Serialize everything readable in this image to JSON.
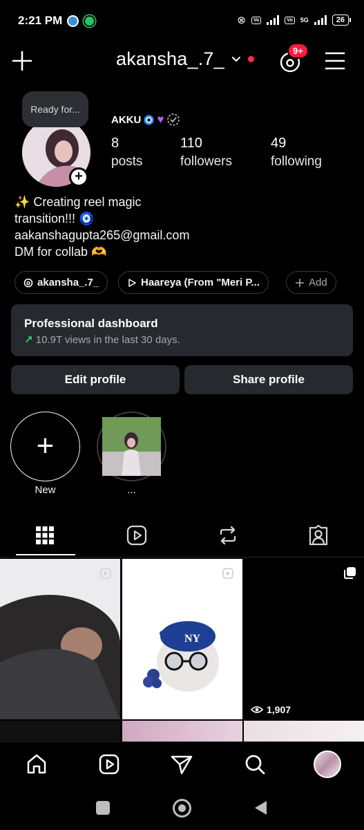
{
  "status_bar": {
    "time": "2:21 PM",
    "network": "5G",
    "battery": "26"
  },
  "header": {
    "username": "akansha_.7_",
    "threads_badge": "9+",
    "icons": [
      "plus-icon",
      "chevron-down-icon",
      "threads-icon",
      "menu-icon"
    ]
  },
  "profile": {
    "note": "Ready for...",
    "display_name": "AKKU",
    "stats": [
      {
        "value": "8",
        "label": "posts"
      },
      {
        "value": "110",
        "label": "followers"
      },
      {
        "value": "49",
        "label": "following"
      }
    ],
    "bio_lines": [
      "✨ Creating reel magic",
      "transition!!! 🧿",
      "aakanshagupta265@gmail.com",
      "DM for collab 🫶"
    ],
    "links": [
      {
        "icon": "threads-icon",
        "label": "akansha_.7_"
      },
      {
        "icon": "play-icon",
        "label": "Haareya (From \"Meri P..."
      },
      {
        "icon": "plus-icon",
        "label": "Add"
      }
    ]
  },
  "dashboard": {
    "title": "Professional dashboard",
    "subtitle": "10.9T views in the last 30 days."
  },
  "actions": {
    "edit_profile": "Edit profile",
    "share_profile": "Share profile"
  },
  "highlights": [
    {
      "label": "New"
    },
    {
      "label": "..."
    }
  ],
  "tabs": [
    "grid-icon",
    "reels-icon",
    "reposts-icon",
    "tagged-icon"
  ],
  "posts": [
    {
      "type": "reel",
      "views": ""
    },
    {
      "type": "reel",
      "views": ""
    },
    {
      "type": "carousel",
      "views": "1,907"
    }
  ],
  "bottom_nav": [
    "home-icon",
    "reels-icon",
    "send-icon",
    "search-icon",
    "profile-avatar"
  ],
  "colors": {
    "background": "#000000",
    "card": "#262a2f",
    "accent_red": "#ff1c3a",
    "trend_green": "#3cd37a"
  }
}
